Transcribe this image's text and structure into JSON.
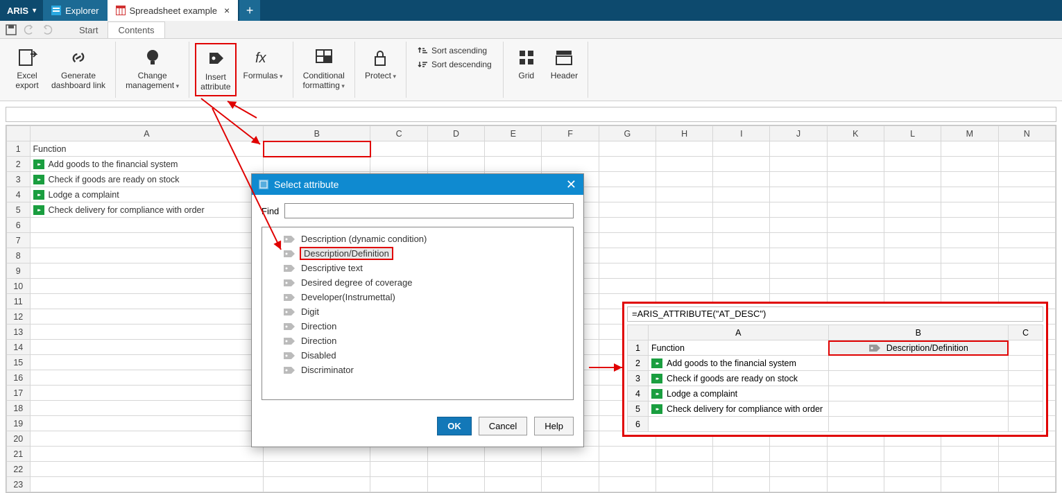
{
  "app": {
    "name": "ARIS"
  },
  "tabs": {
    "explorer": "Explorer",
    "spreadsheet": "Spreadsheet example",
    "close": "×",
    "plus": "+"
  },
  "qtabs": {
    "start": "Start",
    "contents": "Contents"
  },
  "ribbon": {
    "excel_export": "Excel\nexport",
    "dashboard_link": "Generate\ndashboard link",
    "change_mgmt": "Change\nmanagement",
    "insert_attr": "Insert\nattribute",
    "formulas": "Formulas",
    "cond_fmt": "Conditional\nformatting",
    "protect": "Protect",
    "sort_asc": "Sort ascending",
    "sort_desc": "Sort descending",
    "grid": "Grid",
    "header": "Header"
  },
  "columns": [
    "A",
    "B",
    "C",
    "D",
    "E",
    "F",
    "G",
    "H",
    "I",
    "J",
    "K",
    "L",
    "M",
    "N"
  ],
  "rows": {
    "header_label": "Function",
    "items": [
      "Add goods to the financial system",
      "Check if goods are ready on stock",
      "Lodge a complaint",
      "Check delivery for compliance with order"
    ]
  },
  "dialog": {
    "title": "Select attribute",
    "find_label": "Find",
    "items": [
      "Description (dynamic condition)",
      "Description/Definition",
      "Descriptive text",
      "Desired degree of coverage",
      "Developer(Instrumettal)",
      "Digit",
      "Direction",
      "Direction",
      "Disabled",
      "Discriminator"
    ],
    "selected_index": 1,
    "ok": "OK",
    "cancel": "Cancel",
    "help": "Help"
  },
  "result": {
    "formula": "=ARIS_ATTRIBUTE(\"AT_DESC\")",
    "columns": [
      "A",
      "B",
      "C"
    ],
    "header_label": "Function",
    "b1_label": "Description/Definition",
    "items": [
      "Add goods to the financial system",
      "Check if goods are ready on stock",
      "Lodge a complaint",
      "Check delivery for compliance with order"
    ]
  }
}
